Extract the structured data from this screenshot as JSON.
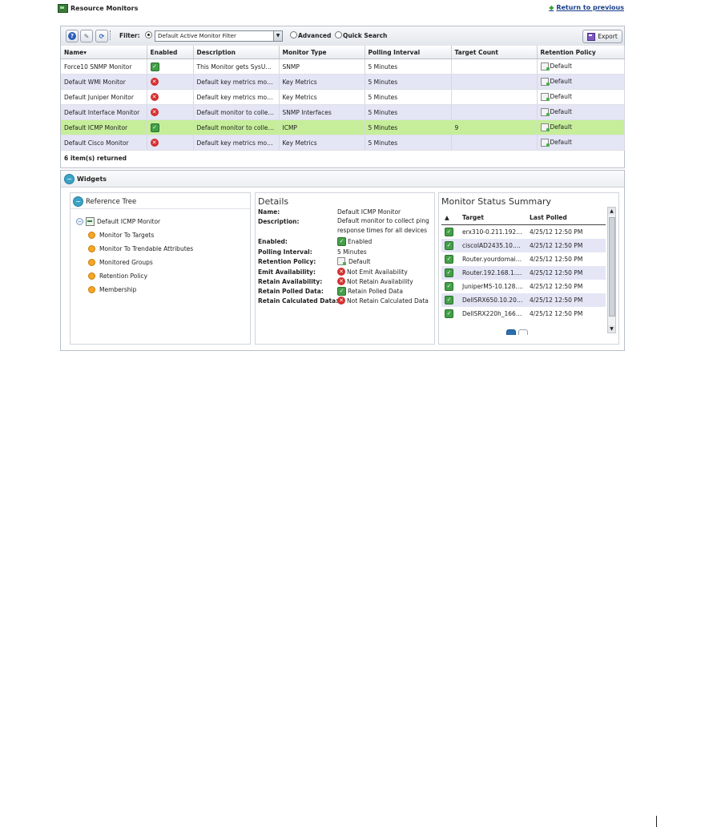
{
  "header": {
    "title": "Resource Monitors",
    "return_link": "Return to previous"
  },
  "toolbar": {
    "filter_label": "Filter:",
    "filter_value": "Default Active Monitor Filter",
    "advanced_label": "Advanced",
    "quick_search_label": "Quick Search",
    "export_label": "Export"
  },
  "monitor_table": {
    "columns": [
      "Name",
      "Enabled",
      "Description",
      "Monitor Type",
      "Polling Interval",
      "Target Count",
      "Retention Policy"
    ],
    "sort_indicator": "▾",
    "rows": [
      {
        "name": "Force10 SNMP Monitor",
        "enabled": true,
        "description": "This Monitor gets SysUpti...",
        "type": "SNMP",
        "interval": "5 Minutes",
        "target_count": "",
        "retention": "Default"
      },
      {
        "name": "Default WMI Monitor",
        "enabled": false,
        "description": "Default key metrics monit...",
        "type": "Key Metrics",
        "interval": "5 Minutes",
        "target_count": "",
        "retention": "Default"
      },
      {
        "name": "Default Juniper Monitor",
        "enabled": false,
        "description": "Default key metrics monit...",
        "type": "Key Metrics",
        "interval": "5 Minutes",
        "target_count": "",
        "retention": "Default"
      },
      {
        "name": "Default Interface Monitor",
        "enabled": false,
        "description": "Default monitor to collect ...",
        "type": "SNMP Interfaces",
        "interval": "5 Minutes",
        "target_count": "",
        "retention": "Default"
      },
      {
        "name": "Default ICMP Monitor",
        "enabled": true,
        "description": "Default monitor to collect ...",
        "type": "ICMP",
        "interval": "5 Minutes",
        "target_count": "9",
        "retention": "Default"
      },
      {
        "name": "Default Cisco Monitor",
        "enabled": false,
        "description": "Default key metrics monit...",
        "type": "Key Metrics",
        "interval": "5 Minutes",
        "target_count": "",
        "retention": "Default"
      }
    ],
    "selected_row": 4,
    "footer": "6 item(s) returned"
  },
  "widgets": {
    "title": "Widgets",
    "reference_tree": {
      "title": "Reference Tree",
      "root": "Default ICMP Monitor",
      "children": [
        "Monitor To Targets",
        "Monitor To Trendable Attributes",
        "Monitored Groups",
        "Retention Policy",
        "Membership"
      ]
    },
    "details": {
      "title": "Details",
      "name_label": "Name:",
      "name_value": "Default ICMP Monitor",
      "description_label": "Description:",
      "description_value": "Default monitor to collect ping response times for all devices",
      "enabled_label": "Enabled:",
      "enabled_value": "Enabled",
      "polling_label": "Polling Interval:",
      "polling_value": "5 Minutes",
      "retention_label": "Retention Policy:",
      "retention_value": "Default",
      "emit_label": "Emit Availability:",
      "emit_value": "Not Emit Availability",
      "retain_avail_label": "Retain Availability:",
      "retain_avail_value": "Not Retain Availability",
      "retain_polled_label": "Retain Polled Data:",
      "retain_polled_value": "Retain Polled Data",
      "retain_calc_label": "Retain Calculated Data:",
      "retain_calc_value": "Not Retain Calculated Data"
    },
    "status_summary": {
      "title": "Monitor Status Summary",
      "sort_icon": "▲",
      "columns": [
        "Target",
        "Last Polled"
      ],
      "rows": [
        {
          "target": "erx310-0.211.192....",
          "last_polled": "4/25/12 12:50 PM"
        },
        {
          "target": "ciscoIAD2435.10.1....",
          "last_polled": "4/25/12 12:50 PM"
        },
        {
          "target": "Router.yourdomain....",
          "last_polled": "4/25/12 12:50 PM"
        },
        {
          "target": "Router.192.168.1....",
          "last_polled": "4/25/12 12:50 PM"
        },
        {
          "target": "JuniperM5-10.128....",
          "last_polled": "4/25/12 12:50 PM"
        },
        {
          "target": "DellSRX650.10.20.1....",
          "last_polled": "4/25/12 12:50 PM"
        },
        {
          "target": "DellSRX220h_166.1....",
          "last_polled": "4/25/12 12:50 PM"
        }
      ]
    }
  }
}
